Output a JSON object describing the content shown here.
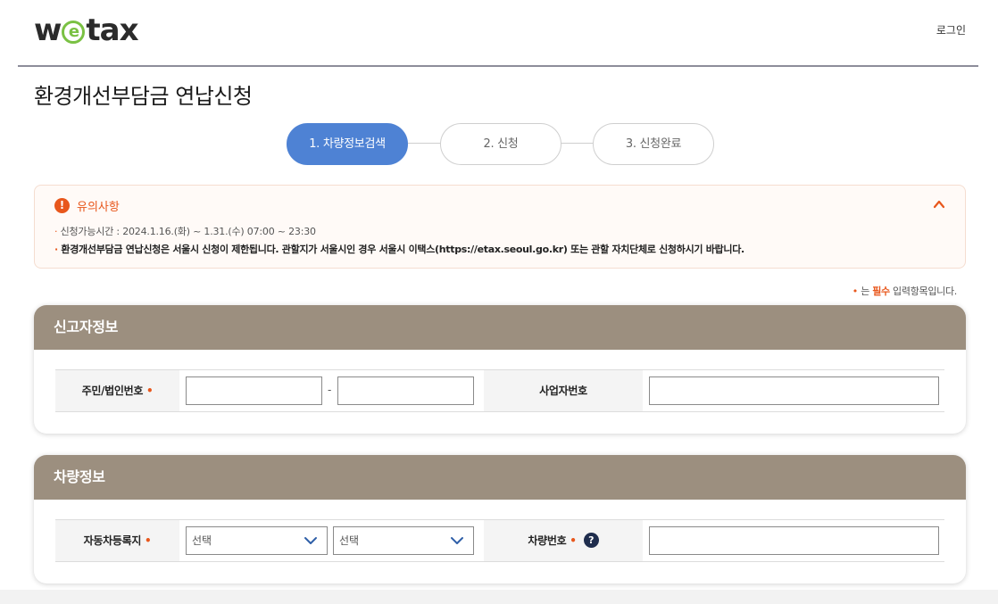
{
  "header": {
    "logo_pre": "w",
    "logo_e": "e",
    "logo_post": "tax",
    "login": "로그인"
  },
  "page": {
    "title": "환경개선부담금 연납신청"
  },
  "steps": [
    {
      "label": "1. 차량정보검색",
      "active": true
    },
    {
      "label": "2. 신청",
      "active": false
    },
    {
      "label": "3. 신청완료",
      "active": false
    }
  ],
  "notice": {
    "icon": "!",
    "title": "유의사항",
    "line1_bullet": "·",
    "line1": " 신청가능시간 : 2024.1.16.(화) ~ 1.31.(수) 07:00 ~ 23:30",
    "line2_bullet": "·",
    "line2": " 환경개선부담금 연납신청은 서울시 신청이 제한됩니다. 관할지가 서울시인 경우 서울시 이택스(https://etax.seoul.go.kr) 또는 관할 자치단체로 신청하시기 바랍니다."
  },
  "required_note": {
    "dot": "•",
    "pre": " 는 ",
    "strong": "필수",
    "post": " 입력항목입니다."
  },
  "reporter_panel": {
    "title": "신고자정보",
    "id_label": "주민/법인번호",
    "required_mark": " •",
    "dash": "-",
    "id_part1": "",
    "id_part2": "",
    "biz_label": "사업자번호",
    "biz_value": ""
  },
  "vehicle_panel": {
    "title": "차량정보",
    "region_label": "자동차등록지",
    "required_mark": " •",
    "select1": "선택",
    "select2": "선택",
    "plate_label": "차량번호",
    "help": "?",
    "plate_value": ""
  },
  "colors": {
    "accent_blue": "#4e82d4",
    "warning_orange": "#e8571c",
    "panel_header": "#9c8f7f",
    "logo_green": "#7ac143"
  }
}
